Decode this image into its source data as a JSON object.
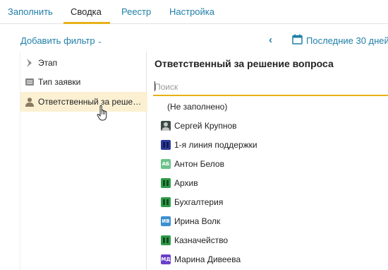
{
  "tabs": [
    {
      "label": "Заполнить",
      "active": false
    },
    {
      "label": "Сводка",
      "active": true
    },
    {
      "label": "Реестр",
      "active": false
    },
    {
      "label": "Настройка",
      "active": false
    }
  ],
  "filter_bar": {
    "add_filter_label": "Добавить фильтр",
    "prev_arrow": "‹",
    "period_label": "Последние 30 дней"
  },
  "left_panel": {
    "items": [
      {
        "label": "Этап",
        "icon": "chevron-right-icon"
      },
      {
        "label": "Тип заявки",
        "icon": "list-icon"
      },
      {
        "label": "Ответственный за решение вопроса",
        "icon": "person-icon",
        "selected": true
      }
    ]
  },
  "right_panel": {
    "title": "Ответственный за решение вопроса",
    "search_placeholder": "Поиск",
    "options": [
      {
        "label": "(Не заполнено)",
        "avatar": "none"
      },
      {
        "label": "Сергей Крупнов",
        "avatar": "photo",
        "color": "#3b4a45"
      },
      {
        "label": "1-я линия поддержки",
        "avatar": "group-icon",
        "color": "#2b3a9a"
      },
      {
        "label": "Антон Белов",
        "avatar": "АБ",
        "color": "#6cc28a"
      },
      {
        "label": "Архив",
        "avatar": "group-icon",
        "color": "#2f9a4a"
      },
      {
        "label": "Бухгалтерия",
        "avatar": "group-icon",
        "color": "#2f9a4a"
      },
      {
        "label": "Ирина Волк",
        "avatar": "ИВ",
        "color": "#3b8fd0"
      },
      {
        "label": "Казначейство",
        "avatar": "group-icon",
        "color": "#2f9a4a"
      },
      {
        "label": "Марина Дивеева",
        "avatar": "МД",
        "color": "#6a3fc9"
      }
    ]
  },
  "colors": {
    "accent": "#e6b21a",
    "link": "#1f7fa8",
    "selected_bg": "#fbf0d2"
  }
}
